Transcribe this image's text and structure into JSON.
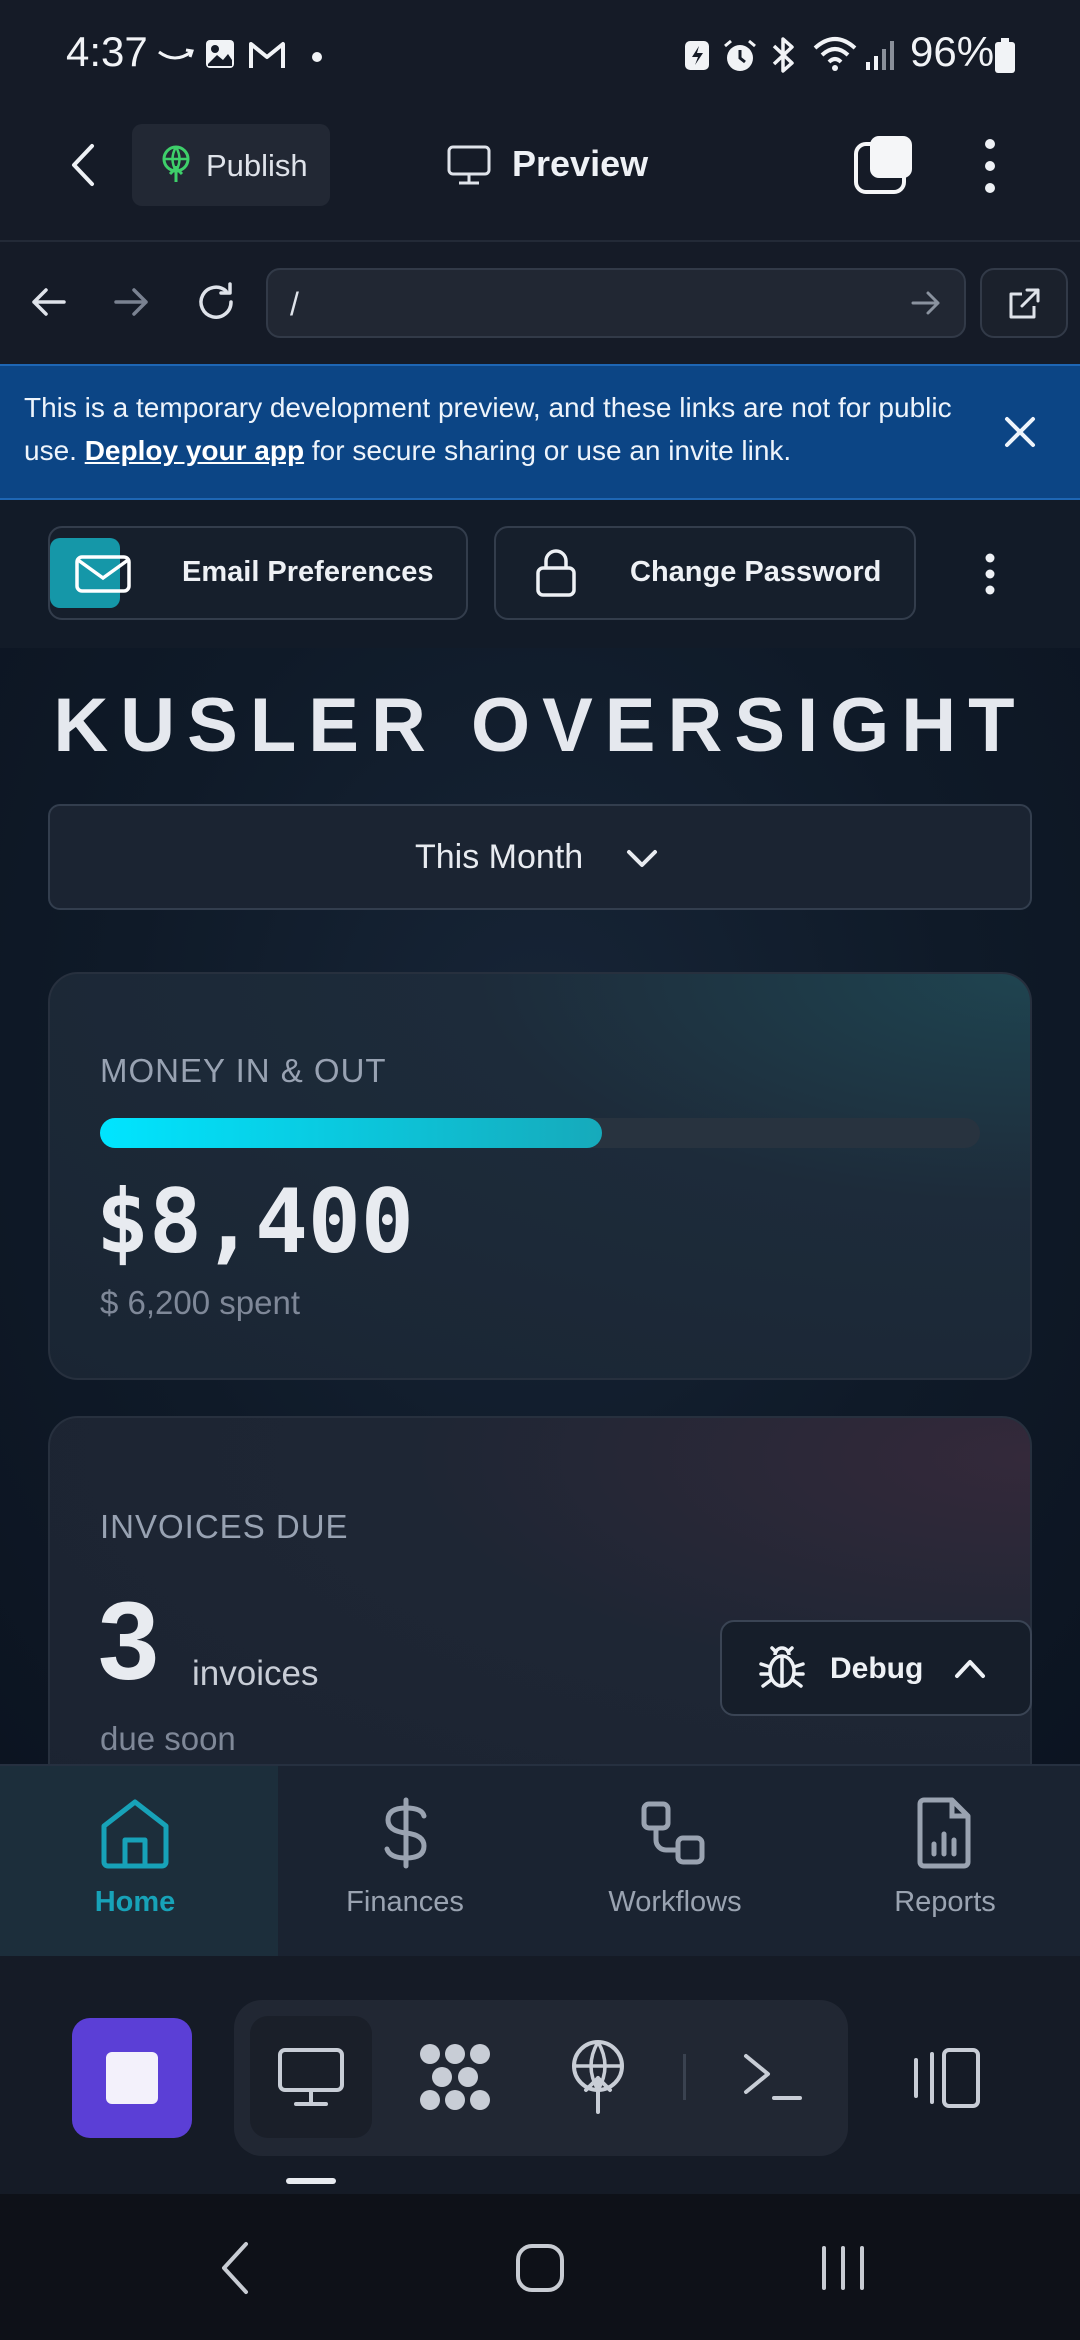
{
  "status_bar": {
    "time": "4:37",
    "battery": "96%"
  },
  "app_bar": {
    "publish_label": "Publish",
    "preview_label": "Preview"
  },
  "browser": {
    "url": "/"
  },
  "banner": {
    "text_before": "This is a temporary development preview, and these links are not for public use. ",
    "link_text": "Deploy your app",
    "text_after": " for secure sharing or use an invite link."
  },
  "toolbar": {
    "email_preferences": "Email Preferences",
    "change_password": "Change Password"
  },
  "app_title": "KUSLER OVERSIGHT",
  "period_select": {
    "selected": "This Month"
  },
  "money_card": {
    "label": "MONEY IN & OUT",
    "amount": "$8,400",
    "subtext": "$ 6,200 spent",
    "progress_fraction": 0.57
  },
  "invoice_card": {
    "label": "INVOICES DUE",
    "count": "3",
    "unit": "invoices",
    "subtext": "due soon"
  },
  "debug": {
    "label": "Debug"
  },
  "tabs": [
    {
      "label": "Home",
      "active": true
    },
    {
      "label": "Finances",
      "active": false
    },
    {
      "label": "Workflows",
      "active": false
    },
    {
      "label": "Reports",
      "active": false
    }
  ],
  "colors": {
    "accent": "#17a2b8",
    "banner": "#0c4585",
    "stop_button": "#5b3fd6",
    "progress": "#00e5ff"
  }
}
